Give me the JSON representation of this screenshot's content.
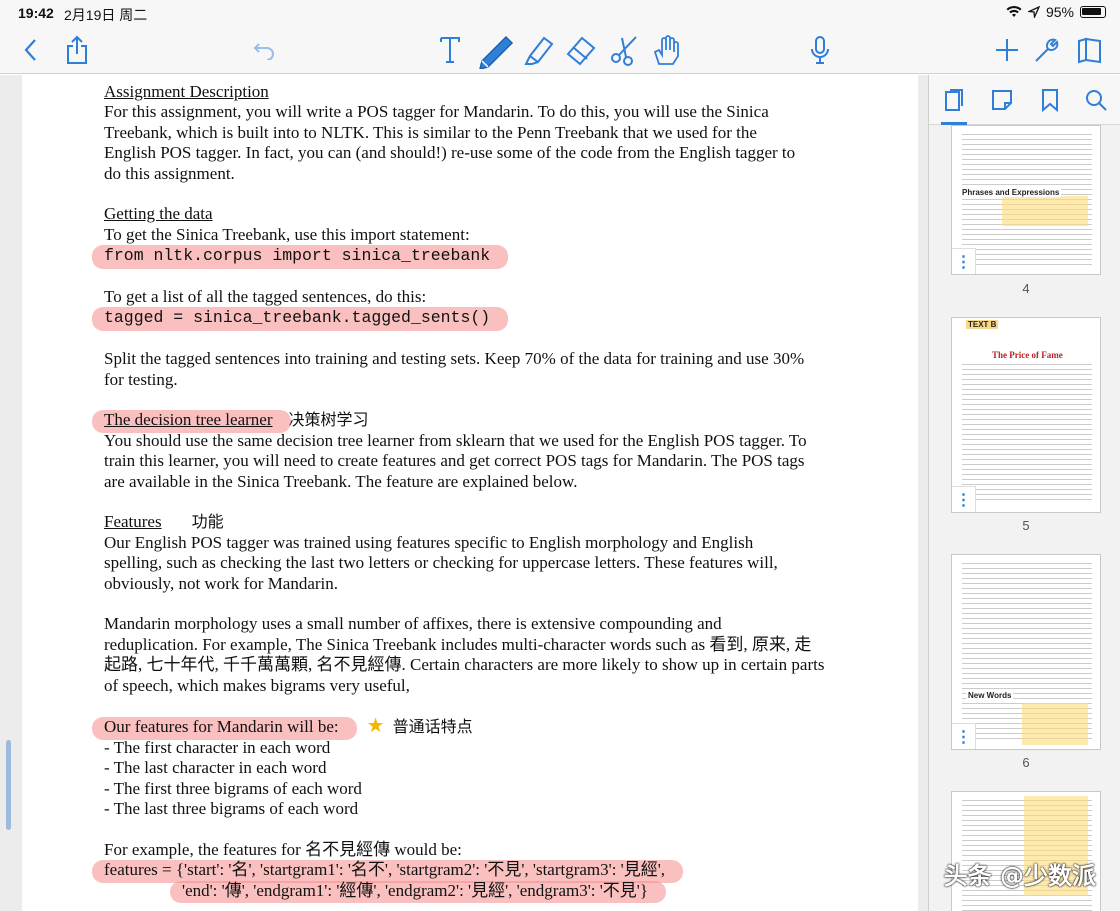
{
  "status": {
    "time": "19:42",
    "date": "2月19日 周二",
    "battery": "95%"
  },
  "toolbar": {
    "back": "back-icon",
    "share": "share-icon",
    "undo": "undo-icon",
    "tools": [
      "text-icon",
      "pen-icon",
      "highlighter-icon",
      "eraser-icon",
      "scissors-icon",
      "hand-icon"
    ],
    "mic": "microphone-icon",
    "add": "plus-icon",
    "settings": "wrench-icon",
    "library": "book-icon"
  },
  "doc": {
    "s1_heading": "Assignment Description",
    "s1_lines": [
      "For this assignment, you will write a POS tagger for Mandarin. To do this, you will use the Sinica",
      "Treebank, which is built into to NLTK. This is similar to the Penn Treebank that we used for the",
      "English POS tagger. In fact, you can (and should!) re-use some of the code from the English tagger to",
      "do this assignment."
    ],
    "s2_heading": "Getting the data",
    "s2_line1": "To get the Sinica Treebank, use this import statement:",
    "s2_code1": "from nltk.corpus import sinica_treebank",
    "s2_line2": "To get a list of all the tagged sentences, do this:",
    "s2_code2": "tagged = sinica_treebank.tagged_sents()",
    "s2_split1": "Split the tagged sentences into training and testing sets. Keep 70% of the data for training and use 30%",
    "s2_split2": "for testing.",
    "s3_heading": "The decision tree learner",
    "s3_note": "决策树学习",
    "s3_lines": [
      "You should use the same decision tree learner from sklearn that we used for the English POS tagger. To",
      "train this learner, you will need to create features and get correct POS tags for Mandarin. The POS tags",
      "are available in the Sinica Treebank. The feature are explained below."
    ],
    "s4_heading": "Features",
    "s4_note": "功能",
    "s4_lines": [
      "Our English POS tagger was trained using features specific to English morphology and English",
      "spelling, such as checking the last two letters or checking for uppercase letters. These features will,",
      "obviously, not work for Mandarin."
    ],
    "s5_lines": [
      "Mandarin morphology uses a small number of affixes, there is extensive compounding and",
      "reduplication. For example, The Sinica Treebank includes multi-character words such as 看到, 原来, 走",
      "起路, 七十年代, 千千萬萬顆, 名不見經傳.  Certain characters are more likely to show up in certain parts",
      "of speech, which makes bigrams very useful,"
    ],
    "s6_heading": "Our features for Mandarin will be:",
    "s6_note": "普通话特点",
    "s6_items": [
      "- The first character in each word",
      "- The last character in each word",
      "- The first three bigrams of each word",
      "- The last three bigrams of each word"
    ],
    "s7_line": "For example, the features for 名不見經傳  would be:",
    "s7_code1": "features = {'start': '名', 'startgram1': '名不', 'startgram2': '不見', 'startgram3': '見經',",
    "s7_code2": "'end': '傳', 'endgram1': '經傳', 'endgram2': '見經', 'endgram3': '不見'}"
  },
  "sidebar": {
    "tabs": [
      "pages-icon",
      "sticky-note-icon",
      "bookmark-icon",
      "search-icon"
    ],
    "pages": [
      {
        "number": "4",
        "label": "Phrases and Expressions"
      },
      {
        "number": "5",
        "label": "TEXT B",
        "title": "The Price of Fame"
      },
      {
        "number": "6",
        "label": "New Words"
      }
    ]
  },
  "watermark": "头条 @少数派"
}
